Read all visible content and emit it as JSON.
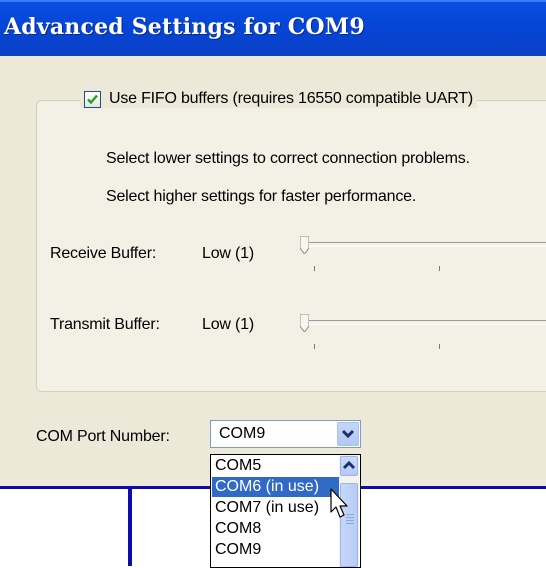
{
  "window": {
    "title": "Advanced Settings for COM9"
  },
  "fifo": {
    "label": "Use FIFO buffers (requires 16550 compatible UART)",
    "checked": true
  },
  "hints": {
    "lower": "Select lower settings to correct connection problems.",
    "higher": "Select higher settings for faster performance."
  },
  "receive": {
    "label": "Receive Buffer:",
    "value_text": "Low (1)"
  },
  "transmit": {
    "label": "Transmit Buffer:",
    "value_text": "Low (1)"
  },
  "com_port": {
    "label": "COM Port Number:",
    "selected": "COM9",
    "options": [
      "COM5",
      "COM6 (in use)",
      "COM7 (in use)",
      "COM8",
      "COM9"
    ],
    "highlighted_index": 1
  },
  "icons": {
    "checkbox": "checkmark-icon",
    "dropdown": "chevron-down-icon",
    "scroll_up": "chevron-up-icon",
    "cursor": "mouse-pointer-icon"
  },
  "colors": {
    "titlebar": "#0546d8",
    "selection": "#316ac5",
    "check": "#21a121",
    "frame": "#0b0bb0"
  }
}
